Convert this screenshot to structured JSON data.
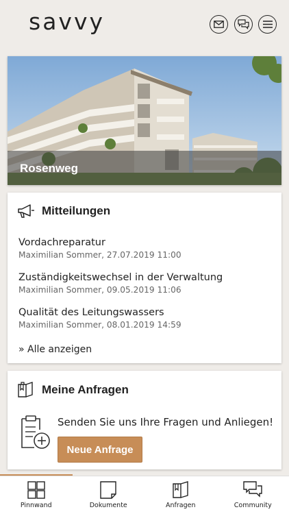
{
  "header": {
    "logo_text": "savvy",
    "icons": [
      "mail-icon",
      "chat-icon",
      "menu-icon"
    ]
  },
  "hero": {
    "title": "Rosenweg"
  },
  "notices": {
    "title": "Mitteilungen",
    "items": [
      {
        "title": "Vordachreparatur",
        "meta": "Maximilian Sommer, 27.07.2019 11:00"
      },
      {
        "title": "Zuständigkeitswechsel in der Verwaltung",
        "meta": "Maximilian Sommer, 09.05.2019 11:06"
      },
      {
        "title": "Qualität des Leitungswassers",
        "meta": "Maximilian Sommer, 08.01.2019 14:59"
      }
    ],
    "show_all": "» Alle anzeigen"
  },
  "requests": {
    "title": "Meine Anfragen",
    "text": "Senden Sie uns Ihre Fragen und Anliegen!",
    "button": "Neue Anfrage"
  },
  "nav": {
    "items": [
      {
        "label": "Pinnwand",
        "icon": "grid-icon"
      },
      {
        "label": "Dokumente",
        "icon": "document-icon"
      },
      {
        "label": "Anfragen",
        "icon": "requests-icon"
      },
      {
        "label": "Community",
        "icon": "community-icon"
      }
    ],
    "active_index": 0
  },
  "colors": {
    "accent": "#c78d57",
    "background": "#efece8",
    "text": "#222222",
    "meta": "#666666"
  }
}
